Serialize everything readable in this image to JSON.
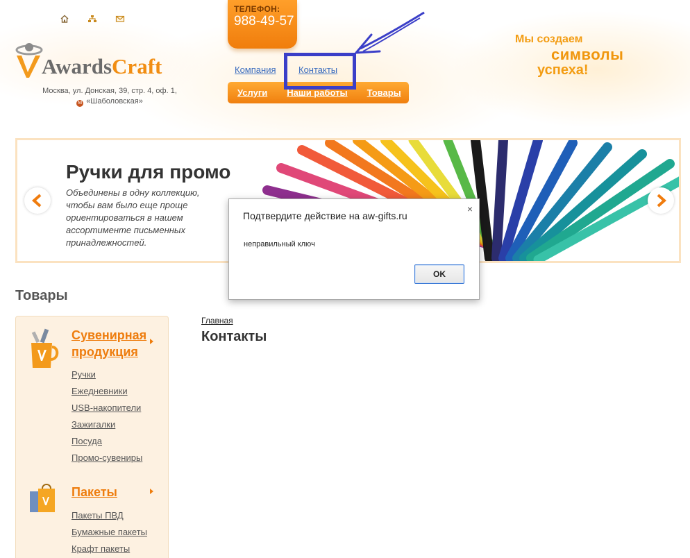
{
  "header": {
    "phone_label": "ТЕЛЕФОН:",
    "phone_number": "988-49-57",
    "logo_awards": "Awards",
    "logo_craft": "Craft",
    "address_line1": "Москва, ул. Донская, 39, стр. 4, оф. 1,",
    "metro": "«Шаболовская»",
    "top_links": [
      "Компания",
      "Контакты"
    ],
    "menu": [
      "Услуги",
      "Наши работы",
      "Товары"
    ],
    "slogan": [
      "Мы создаем",
      "символы",
      "успеха!"
    ],
    "icons": [
      "home-icon",
      "sitemap-icon",
      "mail-icon"
    ]
  },
  "slider": {
    "title": "Ручки для промо",
    "text": "Объединены в одну коллекцию, чтобы вам было еще проще ориентироваться в нашем ассортименте письменных принадлежностей."
  },
  "dialog": {
    "title": "Подтвердите действие на aw-gifts.ru",
    "message": "неправильный ключ",
    "ok_label": "OK",
    "close": "×"
  },
  "sidebar": {
    "section_title": "Товары",
    "categories": [
      {
        "title_line1": "Сувенирная",
        "title_line2": "продукция",
        "items": [
          "Ручки",
          "Ежедневники",
          "USB-накопители",
          "Зажигалки",
          "Посуда",
          "Промо-сувениры"
        ]
      },
      {
        "title_line1": "Пакеты",
        "items": [
          "Пакеты ПВД",
          "Бумажные пакеты",
          "Крафт пакеты"
        ]
      }
    ]
  },
  "main": {
    "breadcrumb": "Главная",
    "title": "Контакты"
  },
  "colors": {
    "accent_orange": "#f08a12",
    "annotation_blue": "#3b3fc8",
    "link_blue": "#3b6dbf"
  }
}
